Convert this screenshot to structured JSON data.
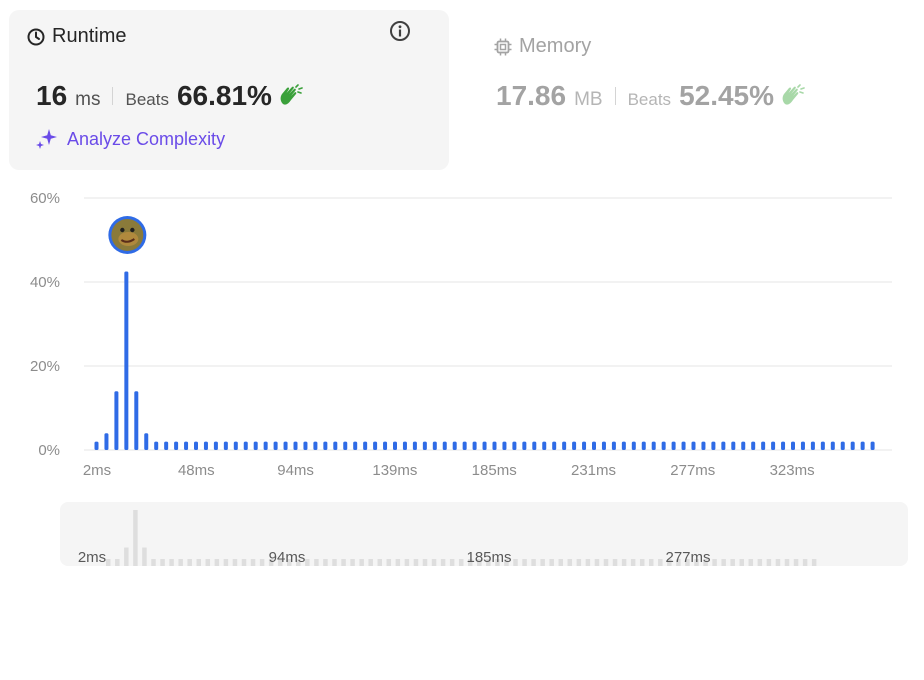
{
  "runtime": {
    "title": "Runtime",
    "value": "16",
    "unit": "ms",
    "beats_label": "Beats",
    "beats_pct": "66.81%",
    "analyze_label": "Analyze Complexity"
  },
  "memory": {
    "title": "Memory",
    "value": "17.86",
    "unit": "MB",
    "beats_label": "Beats",
    "beats_pct": "52.45%"
  },
  "colors": {
    "bar": "#2f6be6",
    "bar_mini": "#dedede",
    "grid": "#e5e5e5",
    "accent_purple": "#6a4be8",
    "hands_green": "#3aa03a"
  },
  "chart_data": {
    "type": "bar",
    "ylim": [
      0,
      60
    ],
    "yticks": [
      "60%",
      "40%",
      "20%",
      "0%"
    ],
    "ytick_values": [
      60,
      40,
      20,
      0
    ],
    "xtick_labels": [
      "2ms",
      "48ms",
      "94ms",
      "139ms",
      "185ms",
      "231ms",
      "277ms",
      "323ms"
    ],
    "values": [
      2,
      4,
      14,
      42.5,
      14,
      4,
      2,
      2,
      2,
      2,
      2,
      2,
      2,
      2,
      2,
      2,
      2,
      2,
      2,
      2,
      2,
      2,
      2,
      2,
      2,
      2,
      2,
      2,
      2,
      2,
      2,
      2,
      2,
      2,
      2,
      2,
      2,
      2,
      2,
      2,
      2,
      2,
      2,
      2,
      2,
      2,
      2,
      2,
      2,
      2,
      2,
      2,
      2,
      2,
      2,
      2,
      2,
      2,
      2,
      2,
      2,
      2,
      2,
      2,
      2,
      2,
      2,
      2,
      2,
      2,
      2,
      2,
      2,
      2,
      2,
      2,
      2,
      2,
      2
    ],
    "highlight_index": 3,
    "grid": true
  },
  "overview": {
    "tick_labels": [
      "2ms",
      "94ms",
      "185ms",
      "277ms"
    ]
  }
}
